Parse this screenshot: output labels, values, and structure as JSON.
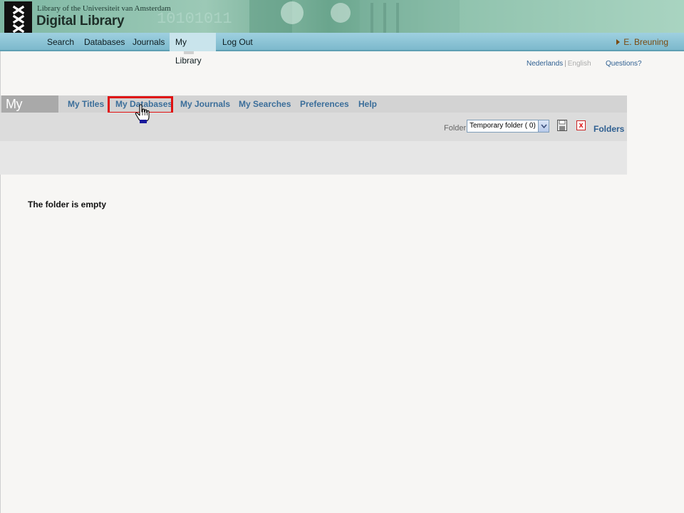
{
  "header": {
    "institution": "Library of the Universiteit van Amsterdam",
    "title": "Digital Library",
    "logo_icon": "uva-crosses-logo-icon"
  },
  "nav": {
    "items": [
      {
        "label": "Search"
      },
      {
        "label": "Databases"
      },
      {
        "label": "Journals"
      },
      {
        "label": "My Library",
        "active": true
      },
      {
        "label": "Log Out"
      }
    ],
    "user": "E. Breuning"
  },
  "lang": {
    "dutch": "Nederlands",
    "separator": "|",
    "english": "English",
    "questions": "Questions?"
  },
  "my_library": {
    "title": "My Library",
    "tabs": [
      {
        "label": "My Titles"
      },
      {
        "label": "My Databases",
        "highlighted": true
      },
      {
        "label": "My Journals"
      },
      {
        "label": "My Searches"
      },
      {
        "label": "Preferences"
      },
      {
        "label": "Help"
      }
    ],
    "folder_label": "Folder:",
    "folder_selected": "Temporary folder ( 0)",
    "folders_link": "Folders",
    "empty_message": "The folder is empty"
  },
  "colors": {
    "highlight": "#e01010",
    "link": "#3b6e9a",
    "navbar": "#8cc4d6"
  }
}
